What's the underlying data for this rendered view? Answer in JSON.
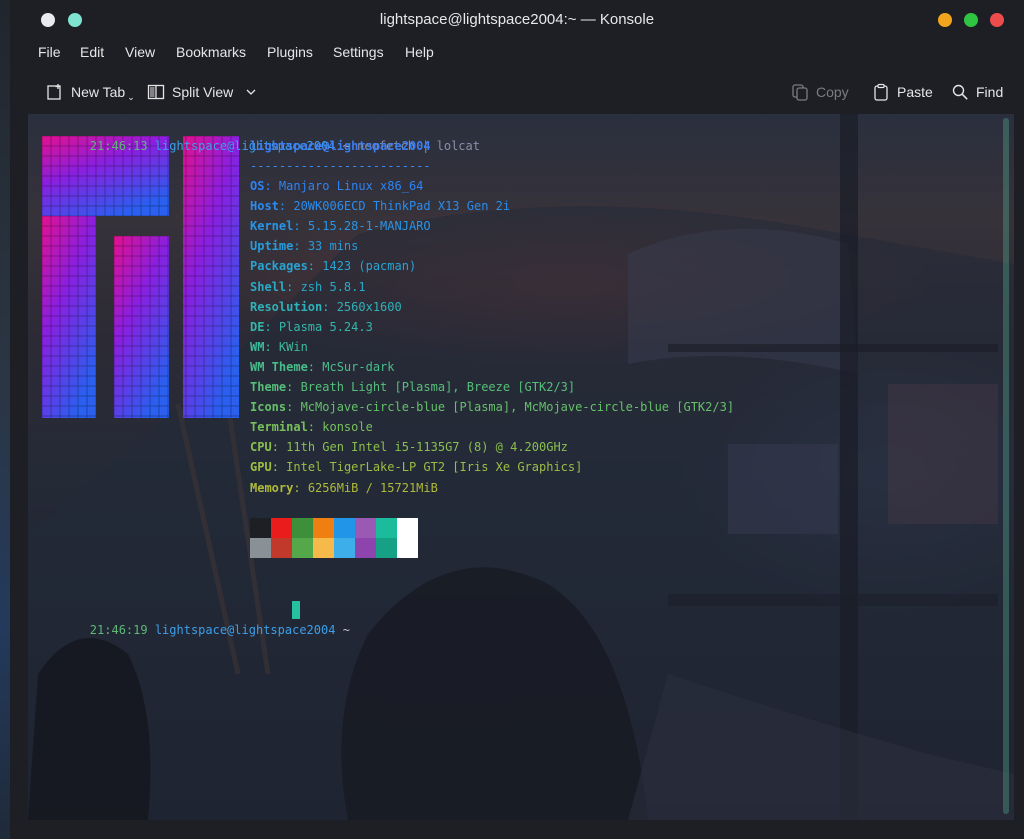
{
  "window": {
    "title": "lightspace@lightspace2004:~ — Konsole",
    "left_controls": [
      {
        "name": "window-menu-dot",
        "color": "#e8eaee"
      },
      {
        "name": "keep-above-dot",
        "color": "#7fe3d0"
      }
    ],
    "right_controls": [
      {
        "name": "minimize-button",
        "color": "#f3a41d"
      },
      {
        "name": "maximize-button",
        "color": "#2fc441"
      },
      {
        "name": "close-button",
        "color": "#ed4c4c"
      }
    ]
  },
  "menu": [
    "File",
    "Edit",
    "View",
    "Bookmarks",
    "Plugins",
    "Settings",
    "Help"
  ],
  "toolbar": {
    "new_tab": "New Tab",
    "split_view": "Split View",
    "copy": "Copy",
    "paste": "Paste",
    "find": "Find"
  },
  "terminal": {
    "prompt1": {
      "time": "21:46:13",
      "user": "lightspace@lightspace2004",
      "dir": "~",
      "command": "neofetch | lolcat"
    },
    "header": "lightspace@lightspace2004",
    "separator": "-------------------------",
    "info": [
      {
        "key": "OS",
        "value": "Manjaro Linux x86_64"
      },
      {
        "key": "Host",
        "value": "20WK006ECD ThinkPad X13 Gen 2i"
      },
      {
        "key": "Kernel",
        "value": "5.15.28-1-MANJARO"
      },
      {
        "key": "Uptime",
        "value": "33 mins"
      },
      {
        "key": "Packages",
        "value": "1423 (pacman)"
      },
      {
        "key": "Shell",
        "value": "zsh 5.8.1"
      },
      {
        "key": "Resolution",
        "value": "2560x1600"
      },
      {
        "key": "DE",
        "value": "Plasma 5.24.3"
      },
      {
        "key": "WM",
        "value": "KWin"
      },
      {
        "key": "WM Theme",
        "value": "McSur-dark"
      },
      {
        "key": "Theme",
        "value": "Breath Light [Plasma], Breeze [GTK2/3]"
      },
      {
        "key": "Icons",
        "value": "McMojave-circle-blue [Plasma], McMojave-circle-blue [GTK2/3]"
      },
      {
        "key": "Terminal",
        "value": "konsole"
      },
      {
        "key": "CPU",
        "value": "11th Gen Intel i5-1135G7 (8) @ 4.200GHz"
      },
      {
        "key": "GPU",
        "value": "Intel TigerLake-LP GT2 [Iris Xe Graphics]"
      },
      {
        "key": "Memory",
        "value": "6256MiB / 15721MiB"
      }
    ],
    "palette_top": [
      "#1e1f24",
      "#ea1c1c",
      "#3e8f3a",
      "#f07f12",
      "#2196e8",
      "#9b59b6",
      "#1abc9c",
      "#ffffff"
    ],
    "palette_bottom": [
      "#8a9196",
      "#c0392b",
      "#55a84a",
      "#f6b94a",
      "#3daee9",
      "#8e44ad",
      "#16a085",
      "#ffffff"
    ],
    "prompt2": {
      "time": "21:46:19",
      "user": "lightspace@lightspace2004",
      "dir": "~"
    },
    "colors": {
      "time": "#5fb878",
      "user": "#3d9ee8",
      "dir": "#c4c6d0",
      "command": "#8890a8"
    }
  }
}
